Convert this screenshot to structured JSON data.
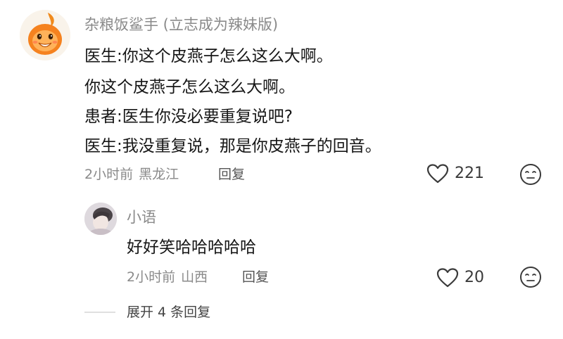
{
  "comment": {
    "username": "杂粮饭鲨手 (立志成为辣妹版)",
    "lines": [
      "医生:你这个皮燕子怎么这么大啊。",
      "你这个皮燕子怎么这么大啊。",
      "患者:医生你没必要重复说吧?",
      "医生:我没重复说，那是你皮燕子的回音。"
    ],
    "time": "2小时前",
    "location": "黑龙江",
    "reply_label": "回复",
    "likes": "221",
    "icons": {
      "like": "heart-outline-icon",
      "dislike": "neutral-face-icon"
    }
  },
  "reply": {
    "username": "小语",
    "text": "好好笑哈哈哈哈哈",
    "time": "2小时前",
    "location": "山西",
    "reply_label": "回复",
    "likes": "20",
    "icons": {
      "like": "heart-outline-icon",
      "dislike": "neutral-face-icon"
    }
  },
  "expand_label": "展开 4 条回复",
  "colors": {
    "avatar_orange": "#f5821f",
    "secondary_text": "#8a8a8a",
    "primary_text": "#161616",
    "divider": "#e0e0e0"
  }
}
